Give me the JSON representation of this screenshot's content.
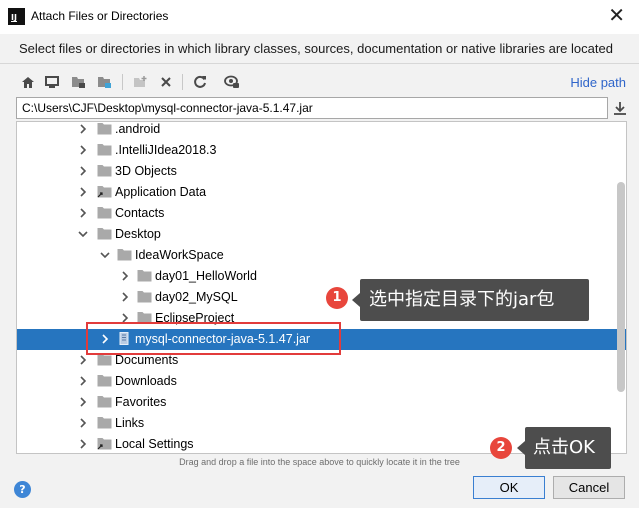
{
  "window": {
    "title": "Attach Files or Directories",
    "close_glyph": "✕"
  },
  "description": "Select files or directories in which library classes, sources, documentation or native libraries are located",
  "toolbar": {
    "icons": [
      "home-icon",
      "desktop-icon",
      "project-folder-icon",
      "module-folder-icon",
      "new-folder-icon",
      "delete-icon",
      "refresh-icon",
      "show-hidden-icon"
    ],
    "hide_path": "Hide path"
  },
  "path_field": {
    "value": "C:\\Users\\CJF\\Desktop\\mysql-connector-java-5.1.47.jar"
  },
  "tree": {
    "rows": [
      {
        "label": ".android",
        "level": 1,
        "expanded": false,
        "icon": "folder-icon",
        "selected": false
      },
      {
        "label": ".IntelliJIdea2018.3",
        "level": 1,
        "expanded": false,
        "icon": "folder-icon",
        "selected": false
      },
      {
        "label": "3D Objects",
        "level": 1,
        "expanded": false,
        "icon": "folder-icon",
        "selected": false
      },
      {
        "label": "Application Data",
        "level": 1,
        "expanded": false,
        "icon": "folder-link-icon",
        "selected": false
      },
      {
        "label": "Contacts",
        "level": 1,
        "expanded": false,
        "icon": "folder-icon",
        "selected": false
      },
      {
        "label": "Desktop",
        "level": 1,
        "expanded": true,
        "icon": "folder-icon",
        "selected": false
      },
      {
        "label": "IdeaWorkSpace",
        "level": 2,
        "expanded": true,
        "icon": "folder-icon",
        "selected": false
      },
      {
        "label": "day01_HelloWorld",
        "level": 3,
        "expanded": false,
        "icon": "folder-icon",
        "selected": false
      },
      {
        "label": "day02_MySQL",
        "level": 3,
        "expanded": false,
        "icon": "folder-icon",
        "selected": false
      },
      {
        "label": "EclipseProject",
        "level": 3,
        "expanded": false,
        "icon": "folder-icon",
        "selected": false
      },
      {
        "label": "mysql-connector-java-5.1.47.jar",
        "level": 2,
        "expanded": false,
        "icon": "jar-icon",
        "selected": true
      },
      {
        "label": "Documents",
        "level": 1,
        "expanded": false,
        "icon": "folder-icon",
        "selected": false
      },
      {
        "label": "Downloads",
        "level": 1,
        "expanded": false,
        "icon": "folder-icon",
        "selected": false
      },
      {
        "label": "Favorites",
        "level": 1,
        "expanded": false,
        "icon": "folder-icon",
        "selected": false
      },
      {
        "label": "Links",
        "level": 1,
        "expanded": false,
        "icon": "folder-icon",
        "selected": false
      },
      {
        "label": "Local Settings",
        "level": 1,
        "expanded": false,
        "icon": "folder-link-icon",
        "selected": false
      }
    ]
  },
  "hint": "Drag and drop a file into the space above to quickly locate it in the tree",
  "buttons": {
    "ok": "OK",
    "cancel": "Cancel",
    "help": "?"
  },
  "annotations": [
    {
      "number": "1",
      "text": "选中指定目录下的jar包"
    },
    {
      "number": "2",
      "text": "点击OK"
    }
  ],
  "colors": {
    "selection": "#2675bf",
    "link": "#2f65ca",
    "annotation_red": "#e8463c",
    "callout_bg": "#4d4d4d"
  }
}
